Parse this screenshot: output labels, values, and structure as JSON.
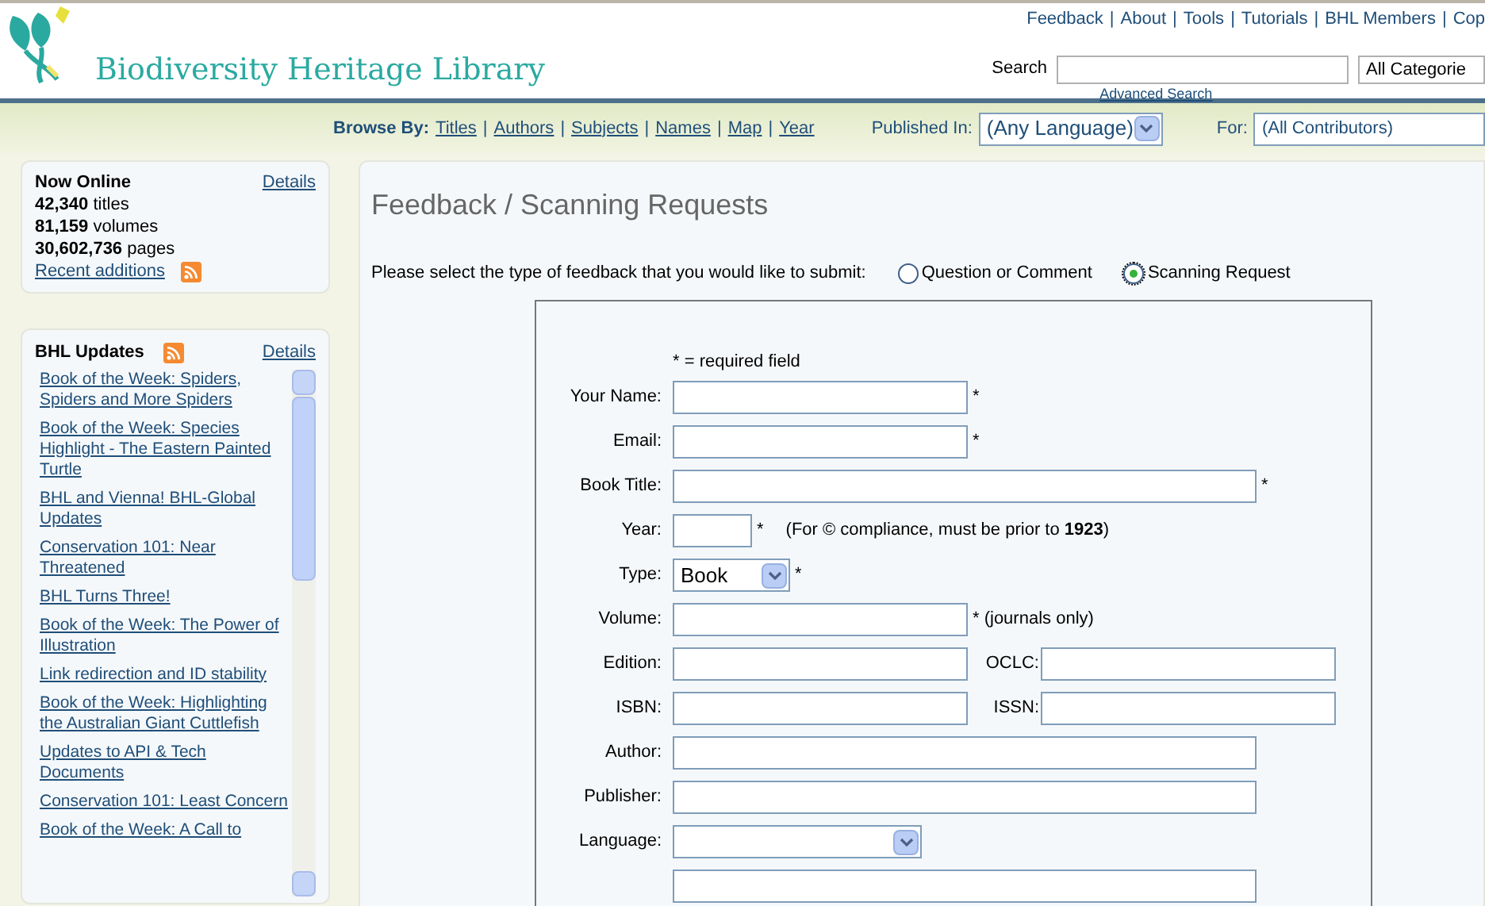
{
  "header": {
    "logo_text": "Biodiversity Heritage Library",
    "top_links": {
      "separator": "|",
      "items": [
        "Feedback",
        "About",
        "Tools",
        "Tutorials",
        "BHL Members",
        "Cop"
      ]
    },
    "search": {
      "label": "Search",
      "category": "All Categorie",
      "advanced": "Advanced Search"
    }
  },
  "nav": {
    "browse_label": "Browse By:",
    "separator": "|",
    "links": [
      "Titles",
      "Authors",
      "Subjects",
      "Names",
      "Map",
      "Year"
    ],
    "published_label": "Published In:",
    "published_value": "(Any Language)",
    "for_label": "For:",
    "for_value": "(All Contributors)"
  },
  "now_online": {
    "title": "Now Online",
    "details": "Details",
    "stats": [
      {
        "number": "42,340",
        "label": "titles"
      },
      {
        "number": "81,159",
        "label": "volumes"
      },
      {
        "number": "30,602,736",
        "label": "pages"
      }
    ],
    "recent": "Recent additions"
  },
  "updates": {
    "title": "BHL Updates",
    "details": "Details",
    "items": [
      "Book of the Week: Spiders, Spiders and More Spiders",
      "Book of the Week: Species Highlight - The Eastern Painted Turtle",
      "BHL and Vienna! BHL-Global Updates",
      "Conservation 101: Near Threatened",
      "BHL Turns Three!",
      "Book of the Week: The Power of Illustration",
      "Link redirection and ID stability",
      "Book of the Week: Highlighting the Australian Giant Cuttlefish",
      "Updates to API & Tech Documents",
      "Conservation 101: Least Concern",
      "Book of the Week: A Call to"
    ]
  },
  "main": {
    "title": "Feedback / Scanning Requests",
    "prompt": "Please select the type of feedback that you would like to submit:",
    "options": [
      {
        "label": "Question or Comment",
        "selected": false
      },
      {
        "label": "Scanning Request",
        "selected": true
      }
    ],
    "required_note": "* = required field",
    "rows": [
      {
        "label": "Your Name:",
        "kind": "medium",
        "suffix": "*"
      },
      {
        "label": "Email:",
        "kind": "medium",
        "suffix": "*"
      },
      {
        "label": "Book Title:",
        "kind": "long",
        "suffix": "*"
      },
      {
        "label": "Year:",
        "kind": "short",
        "suffix": "*",
        "note": "(For © compliance, must be prior to **1923**)"
      },
      {
        "label": "Type:",
        "kind": "dropdown",
        "value": "Book",
        "suffix": "*"
      },
      {
        "label": "Volume:",
        "kind": "medium",
        "suffix": "* (journals only)"
      },
      {
        "label": "Edition:",
        "kind": "pair",
        "label2": "OCLC:"
      },
      {
        "label": "ISBN:",
        "kind": "pair",
        "label2": "ISSN:"
      },
      {
        "label": "Author:",
        "kind": "long"
      },
      {
        "label": "Publisher:",
        "kind": "long"
      },
      {
        "label": "Language:",
        "kind": "wide-dropdown"
      },
      {
        "kind": "long"
      }
    ]
  }
}
